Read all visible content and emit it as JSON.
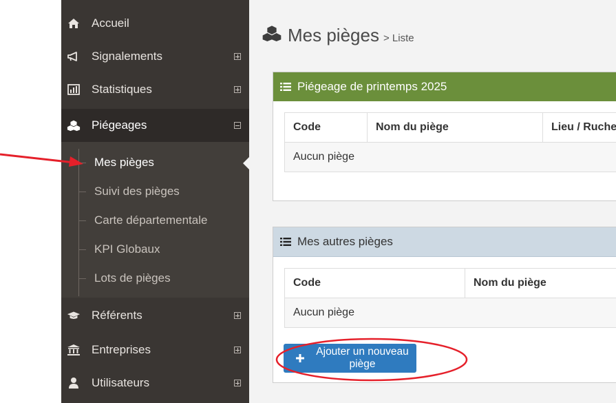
{
  "sidebar": {
    "items": [
      {
        "label": "Accueil",
        "icon": "home-icon"
      },
      {
        "label": "Signalements",
        "icon": "megaphone-icon"
      },
      {
        "label": "Statistiques",
        "icon": "bar-chart-icon"
      },
      {
        "label": "Piégeages",
        "icon": "cubes-icon"
      },
      {
        "label": "Référents",
        "icon": "graduation-cap-icon"
      },
      {
        "label": "Entreprises",
        "icon": "institution-icon"
      },
      {
        "label": "Utilisateurs",
        "icon": "user-icon"
      }
    ],
    "submenu": [
      {
        "label": "Mes pièges"
      },
      {
        "label": "Suivi des pièges"
      },
      {
        "label": "Carte départementale"
      },
      {
        "label": "KPI Globaux"
      },
      {
        "label": "Lots de pièges"
      }
    ]
  },
  "header": {
    "title": "Mes pièges",
    "breadcrumb": "> Liste"
  },
  "panel1": {
    "title": "Piégeage de printemps 2025",
    "columns": [
      "Code",
      "Nom du piège",
      "Lieu / Ruche"
    ],
    "empty": "Aucun piège"
  },
  "panel2": {
    "title": "Mes autres pièges",
    "columns": [
      "Code",
      "Nom du piège"
    ],
    "empty": "Aucun piège"
  },
  "actions": {
    "add_label": "Ajouter un nouveau piège"
  },
  "colors": {
    "sidebar": "#3a3633",
    "green_header": "#6b8f3b",
    "blue_header": "#cdd9e3",
    "button": "#2f7bbf",
    "annotation": "#e5202a"
  }
}
